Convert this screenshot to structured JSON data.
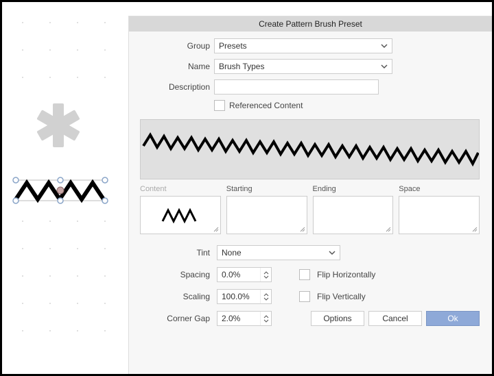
{
  "dialog": {
    "title": "Create Pattern Brush Preset",
    "labels": {
      "group": "Group",
      "name": "Name",
      "description": "Description",
      "ref_content": "Referenced Content",
      "content": "Content",
      "starting": "Starting",
      "ending": "Ending",
      "space": "Space",
      "tint": "Tint",
      "spacing": "Spacing",
      "scaling": "Scaling",
      "corner_gap": "Corner Gap",
      "flip_h": "Flip Horizontally",
      "flip_v": "Flip Vertically"
    },
    "values": {
      "group": "Presets",
      "name": "Brush Types",
      "description": "",
      "tint": "None",
      "spacing": "0.0%",
      "scaling": "100.0%",
      "corner_gap": "2.0%"
    },
    "buttons": {
      "options": "Options",
      "cancel": "Cancel",
      "ok": "Ok"
    }
  },
  "colors": {
    "primary_btn": "#8ea9d8",
    "panel_bg": "#f7f7f7",
    "titlebar_bg": "#d8d8d8"
  }
}
